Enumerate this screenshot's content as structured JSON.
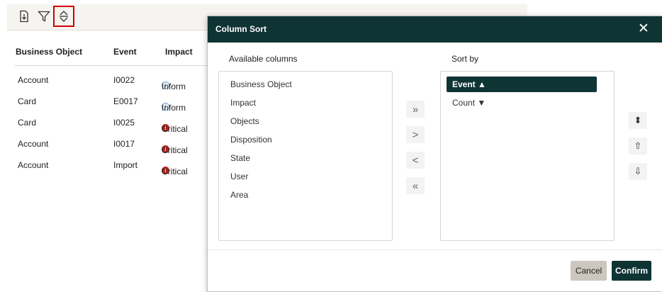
{
  "toolbar": {
    "icons": [
      "export-icon",
      "filter-icon",
      "sort-icon"
    ]
  },
  "table": {
    "headers": [
      "Business Object",
      "Event",
      "Impact"
    ],
    "rows": [
      {
        "business_object": "Account",
        "event": "I0022",
        "impact": "Inform",
        "impact_icon": "info-icon"
      },
      {
        "business_object": "Card",
        "event": "E0017",
        "impact": "Inform",
        "impact_icon": "info-icon"
      },
      {
        "business_object": "Card",
        "event": "I0025",
        "impact": "Critical",
        "impact_icon": "critical-icon"
      },
      {
        "business_object": "Account",
        "event": "I0017",
        "impact": "Critical",
        "impact_icon": "critical-icon"
      },
      {
        "business_object": "Account",
        "event": "Import",
        "impact": "Critical",
        "impact_icon": "critical-icon"
      }
    ]
  },
  "modal": {
    "title": "Column Sort",
    "close_glyph": "✕",
    "available_label": "Available columns",
    "sortby_label": "Sort by",
    "available_columns": [
      "Business Object",
      "Impact",
      "Objects",
      "Disposition",
      "State",
      "User",
      "Area"
    ],
    "sort_by": [
      {
        "label": "Event ▲",
        "selected": true
      },
      {
        "label": "Count ▼",
        "selected": false
      }
    ],
    "move_buttons": {
      "add_all": "»",
      "add": ">",
      "remove": "<",
      "remove_all": "«"
    },
    "order_buttons": {
      "toggle_direction": "⬍",
      "move_up": "⇧",
      "move_down": "⇩"
    },
    "cancel_label": "Cancel",
    "confirm_label": "Confirm"
  },
  "colors": {
    "header_bg": "#0f3434",
    "critical": "#b3261e",
    "info": "#6a9fd8",
    "highlight": "#d40000"
  }
}
